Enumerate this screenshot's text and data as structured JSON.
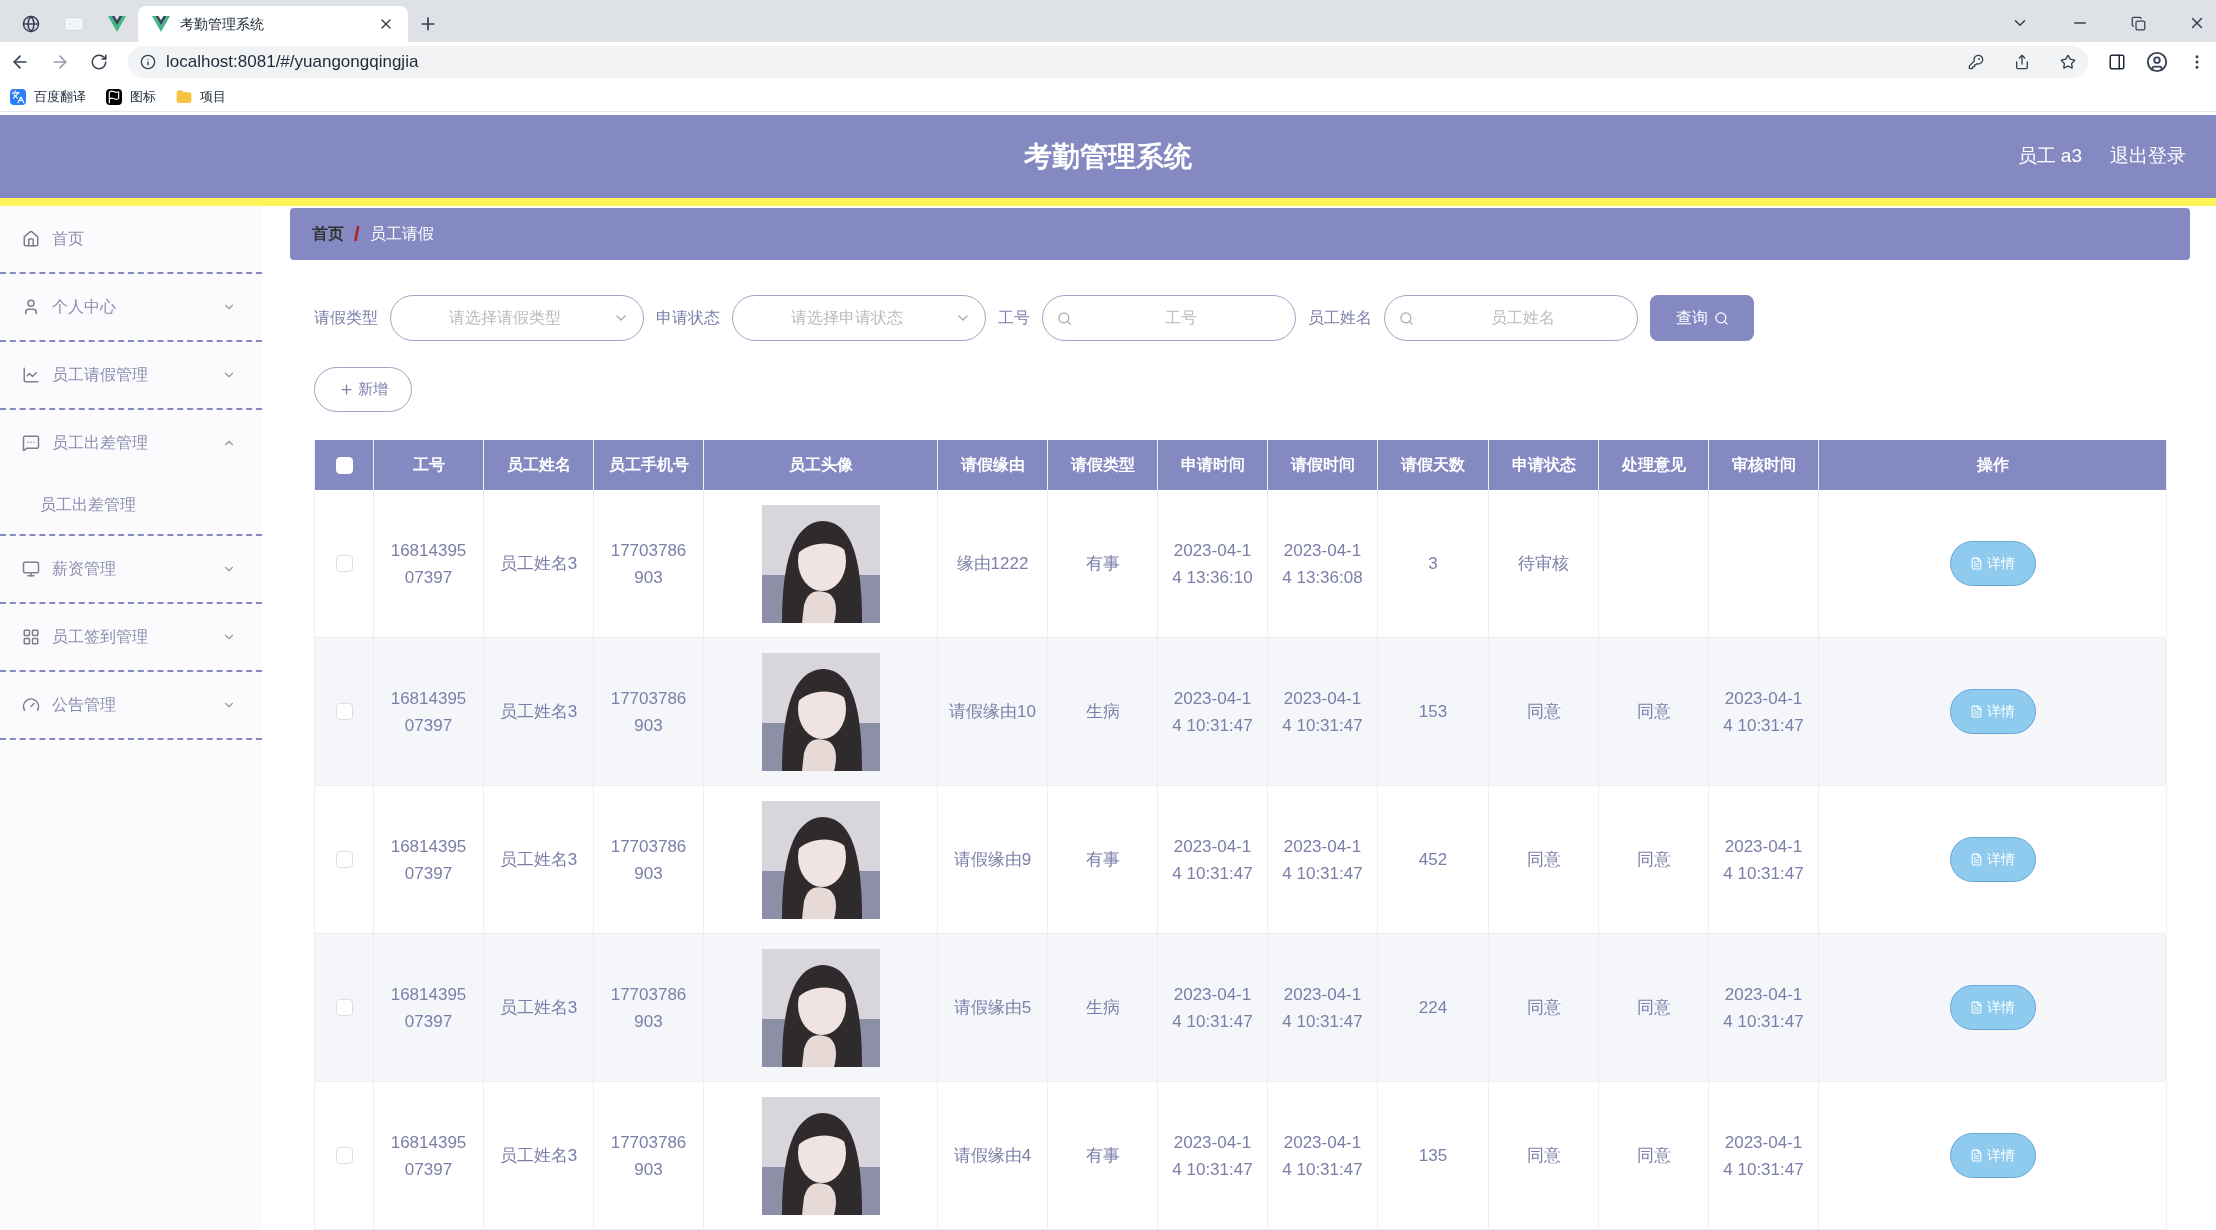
{
  "browser": {
    "tabs": [
      {
        "kind": "globe",
        "selected": false
      },
      {
        "kind": "blank",
        "selected": false
      },
      {
        "kind": "vue",
        "selected": false
      },
      {
        "kind": "vue",
        "title": "考勤管理系统",
        "selected": true
      }
    ],
    "url": "localhost:8081/#/yuangongqingjia",
    "bookmarks": [
      {
        "kind": "translate",
        "label": "百度翻译"
      },
      {
        "kind": "flag",
        "label": "图标"
      },
      {
        "kind": "folder",
        "label": "项目"
      }
    ]
  },
  "header": {
    "title": "考勤管理系统",
    "user": "员工 a3",
    "logout": "退出登录"
  },
  "sidebar": {
    "items": [
      {
        "kind": "home",
        "label": "首页"
      },
      {
        "kind": "user",
        "label": "个人中心",
        "expandable": true,
        "expanded": false
      },
      {
        "kind": "chart",
        "label": "员工请假管理",
        "expandable": true,
        "expanded": false
      },
      {
        "kind": "message",
        "label": "员工出差管理",
        "expandable": true,
        "expanded": true,
        "children": [
          {
            "label": "员工出差管理"
          }
        ]
      },
      {
        "kind": "monitor",
        "label": "薪资管理",
        "expandable": true,
        "expanded": false
      },
      {
        "kind": "grid",
        "label": "员工签到管理",
        "expandable": true,
        "expanded": false
      },
      {
        "kind": "gauge",
        "label": "公告管理",
        "expandable": true,
        "expanded": false
      }
    ]
  },
  "breadcrumb": {
    "items": [
      "首页",
      "员工请假"
    ],
    "separator": "/"
  },
  "filters": [
    {
      "kind": "select",
      "label": "请假类型",
      "placeholder": "请选择请假类型"
    },
    {
      "kind": "select",
      "label": "申请状态",
      "placeholder": "请选择申请状态"
    },
    {
      "kind": "search",
      "label": "工号",
      "placeholder": "工号"
    },
    {
      "kind": "search",
      "label": "员工姓名",
      "placeholder": "员工姓名"
    }
  ],
  "query_button": "查询",
  "add_button": "新增",
  "table": {
    "all_checked": false,
    "columns": [
      "工号",
      "员工姓名",
      "员工手机号",
      "员工头像",
      "请假缘由",
      "请假类型",
      "申请时间",
      "请假时间",
      "请假天数",
      "申请状态",
      "处理意见",
      "审核时间",
      "操作"
    ],
    "rows": [
      {
        "checked": false,
        "cells": [
          "1681439507397",
          "员工姓名3",
          "17703786903",
          "",
          "缘由1222",
          "有事",
          "2023-04-14 13:36:10",
          "2023-04-14 13:36:08",
          "3",
          "待审核",
          "",
          ""
        ],
        "action": "详情"
      },
      {
        "checked": false,
        "cells": [
          "1681439507397",
          "员工姓名3",
          "17703786903",
          "",
          "请假缘由10",
          "生病",
          "2023-04-14 10:31:47",
          "2023-04-14 10:31:47",
          "153",
          "同意",
          "同意",
          "2023-04-14 10:31:47"
        ],
        "action": "详情"
      },
      {
        "checked": false,
        "cells": [
          "1681439507397",
          "员工姓名3",
          "17703786903",
          "",
          "请假缘由9",
          "有事",
          "2023-04-14 10:31:47",
          "2023-04-14 10:31:47",
          "452",
          "同意",
          "同意",
          "2023-04-14 10:31:47"
        ],
        "action": "详情"
      },
      {
        "checked": false,
        "cells": [
          "1681439507397",
          "员工姓名3",
          "17703786903",
          "",
          "请假缘由5",
          "生病",
          "2023-04-14 10:31:47",
          "2023-04-14 10:31:47",
          "224",
          "同意",
          "同意",
          "2023-04-14 10:31:47"
        ],
        "action": "详情"
      },
      {
        "checked": false,
        "cells": [
          "1681439507397",
          "员工姓名3",
          "17703786903",
          "",
          "请假缘由4",
          "有事",
          "2023-04-14 10:31:47",
          "2023-04-14 10:31:47",
          "135",
          "同意",
          "同意",
          "2023-04-14 10:31:47"
        ],
        "action": "详情"
      }
    ]
  }
}
